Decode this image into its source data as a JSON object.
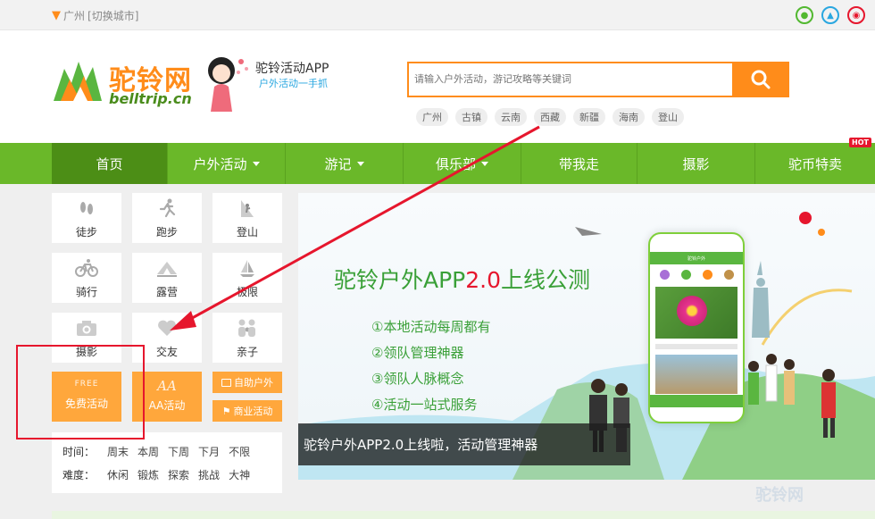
{
  "topbar": {
    "city": "广州",
    "switch_city": "[切换城市]"
  },
  "logo": {
    "cn": "驼铃网",
    "en": "belltrip.cn"
  },
  "promo": {
    "app_title": "驼铃活动APP",
    "app_sub": "户外活动一手抓"
  },
  "search": {
    "placeholder": "请输入户外活动，游记攻略等关键词",
    "tags": [
      "广州",
      "古镇",
      "云南",
      "西藏",
      "新疆",
      "海南",
      "登山"
    ]
  },
  "nav": {
    "items": [
      "首页",
      "户外活动",
      "游记",
      "俱乐部",
      "带我走",
      "摄影",
      "驼币特卖"
    ],
    "hot_badge": "HOT"
  },
  "categories": {
    "items": [
      "徒步",
      "跑步",
      "登山",
      "骑行",
      "露营",
      "极限",
      "摄影",
      "交友",
      "亲子"
    ],
    "free_badge": "FREE",
    "free_label": "免费活动",
    "aa_badge": "AA",
    "aa_label": "AA活动",
    "self_help": "自助户外",
    "commercial": "商业活动"
  },
  "filters": {
    "time_label": "时间：",
    "time_options": [
      "周末",
      "本周",
      "下周",
      "下月",
      "不限"
    ],
    "difficulty_label": "难度：",
    "difficulty_options": [
      "休闲",
      "锻炼",
      "探索",
      "挑战",
      "大神"
    ]
  },
  "banner": {
    "title_pre": "驼铃户外APP",
    "title_ver": "2.0",
    "title_post": "上线公测",
    "bullets": [
      "①本地活动每周都有",
      "②领队管理神器",
      "③领队人脉概念",
      "④活动一站式服务"
    ],
    "caption": "驼铃户外APP2.0上线啦，活动管理神器",
    "phone_header": "驼铃户外"
  },
  "watermark": "驼铃网",
  "colors": {
    "green": "#6ab829",
    "orange": "#ffa73c",
    "search_orange": "#ff8c1a",
    "annotation_red": "#e6162d"
  }
}
